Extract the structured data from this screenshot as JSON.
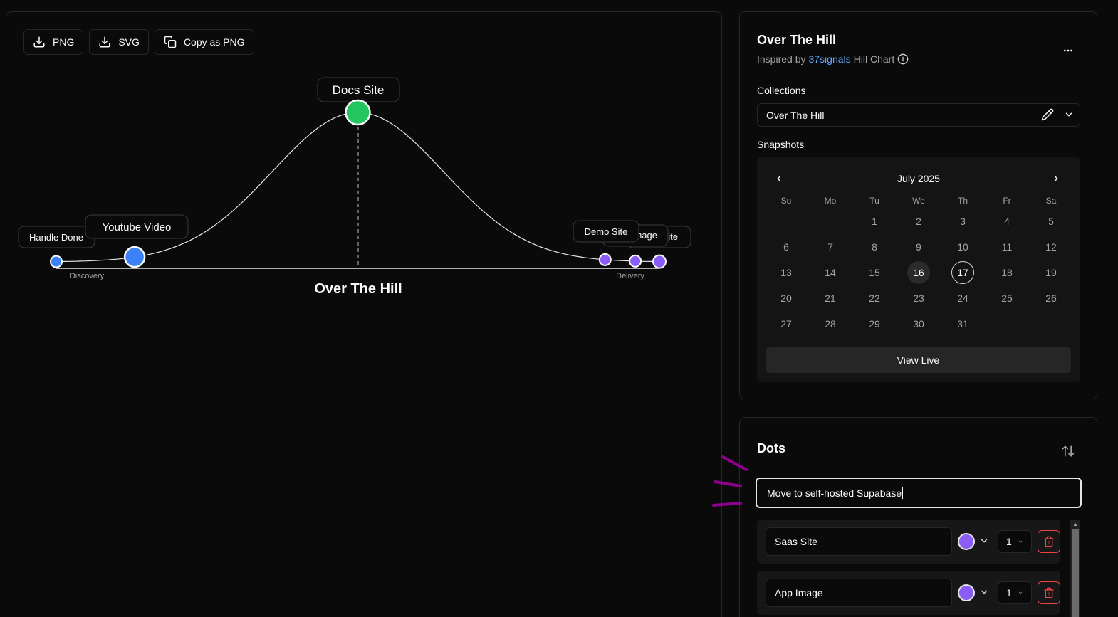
{
  "toolbar": {
    "png_label": "PNG",
    "svg_label": "SVG",
    "copy_label": "Copy as PNG"
  },
  "hill_chart": {
    "title": "Over The Hill",
    "left_label": "Discovery",
    "right_label": "Delivery",
    "dots": [
      {
        "label": "Handle Done",
        "color": "#3b82f6",
        "size": "small",
        "progress": 0.0
      },
      {
        "label": "Youtube Video",
        "color": "#3b82f6",
        "size": "large",
        "progress": 0.13
      },
      {
        "label": "Docs Site",
        "color": "#22c55e",
        "size": "large",
        "progress": 0.5
      },
      {
        "label": "Demo Site",
        "color": "#8b5cf6",
        "size": "small",
        "progress": 0.91
      },
      {
        "label": "App Image",
        "color": "#8b5cf6",
        "size": "small",
        "progress": 0.96
      },
      {
        "label": "Saas Site",
        "color": "#8b5cf6",
        "size": "small",
        "progress": 1.0
      }
    ],
    "partial_labels": {
      "app_image": "Image",
      "saas_site": "ite"
    }
  },
  "project": {
    "title": "Over The Hill",
    "inspired_prefix": "Inspired by",
    "inspired_link": "37signals",
    "inspired_suffix": "Hill Chart"
  },
  "collections": {
    "label": "Collections",
    "selected": "Over The Hill"
  },
  "snapshots": {
    "label": "Snapshots",
    "month": "July 2025",
    "weekdays": [
      "Su",
      "Mo",
      "Tu",
      "We",
      "Th",
      "Fr",
      "Sa"
    ],
    "weeks": [
      [
        "",
        "",
        "1",
        "2",
        "3",
        "4",
        "5"
      ],
      [
        "6",
        "7",
        "8",
        "9",
        "10",
        "11",
        "12"
      ],
      [
        "13",
        "14",
        "15",
        "16",
        "17",
        "18",
        "19"
      ],
      [
        "20",
        "21",
        "22",
        "23",
        "24",
        "25",
        "26"
      ],
      [
        "27",
        "28",
        "29",
        "30",
        "31",
        "",
        ""
      ]
    ],
    "today": "16",
    "selected": "17",
    "view_live": "View Live"
  },
  "dots_panel": {
    "title": "Dots",
    "new_dot_value": "Move to self-hosted Supabase",
    "items": [
      {
        "name": "Saas Site",
        "color": "#8b5cf6",
        "size": "1"
      },
      {
        "name": "App Image",
        "color": "#8b5cf6",
        "size": "1"
      }
    ]
  }
}
